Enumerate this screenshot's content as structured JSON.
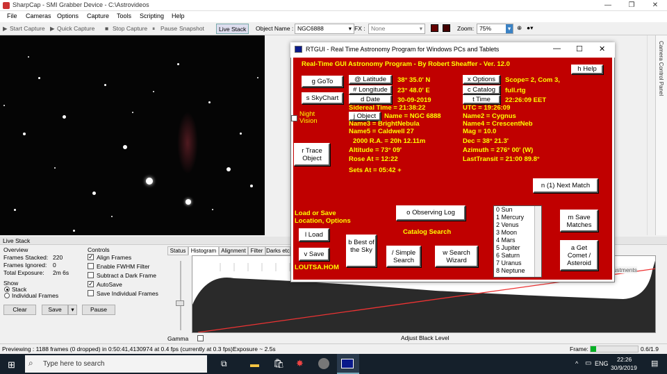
{
  "window": {
    "title": "SharpCap - SMI Grabber Device - C:\\Astrovideos"
  },
  "menu": [
    "File",
    "Cameras",
    "Options",
    "Capture",
    "Tools",
    "Scripting",
    "Help"
  ],
  "toolbar": {
    "start": "Start Capture",
    "quick": "Quick Capture",
    "stop": "Stop Capture",
    "pause": "Pause",
    "snapshot": "Snapshot",
    "livestack": "Live Stack",
    "object_label": "Object Name :",
    "object_value": "NGC6888",
    "fx_label": "FX :",
    "fx_value": "None",
    "zoom_label": "Zoom:",
    "zoom_value": "75%"
  },
  "side_panel": {
    "label": "Camera Control Panel"
  },
  "live_stack": {
    "title": "Live Stack",
    "overview_label": "Overview",
    "frames_stacked_label": "Frames Stacked:",
    "frames_stacked": "220",
    "frames_ignored_label": "Frames Ignored:",
    "frames_ignored": "0",
    "total_exposure_label": "Total Exposure:",
    "total_exposure": "2m 6s",
    "show_label": "Show",
    "show_stack": "Stack",
    "show_individual": "Individual Frames",
    "controls_label": "Controls",
    "align": "Align Frames",
    "fwhm": "Enable FWHM Filter",
    "dark": "Subtract a Dark Frame",
    "autosave": "AutoSave",
    "save_individual": "Save Individual Frames",
    "clear": "Clear",
    "save": "Save",
    "pause": "Pause",
    "tabs": [
      "Status",
      "Histogram",
      "Alignment",
      "Filter",
      "Darks etc"
    ],
    "gamma": "Gamma",
    "adjust_black": "Adjust Black Level",
    "adjustments": "t Adjustments"
  },
  "status": {
    "text": "Previewing : 1188 frames (0 dropped) in 0:50:41,4130974 at 0.4 fps  (currently at 0.3 fps)Exposure ~ 2.5s",
    "frame_label": "Frame:",
    "frame_value": "0.6/1.9"
  },
  "taskbar": {
    "search": "Type here to search",
    "lang": "ENG",
    "time": "22:26",
    "date": "30/9/2019"
  },
  "rtgui": {
    "title": "RTGUI - Real Time Astronomy Program for Windows PCs and Tablets",
    "heading": "Real-Time GUI Astronomy Program - By Robert Sheaffer - Ver. 12.0",
    "help": "h Help",
    "goto": "g GoTo",
    "skychart": "s SkyChart",
    "latitude_btn": "@ Latitude",
    "longitude_btn": "# Longitude",
    "date_btn": "d Date",
    "latitude": "38° 35.0'  N",
    "longitude": "23° 48.0'  E",
    "date": "30-09-2019",
    "options_btn": "x Options",
    "catalog_btn": "c Catalog",
    "time_btn": "t Time",
    "scope": "Scope= 2, Com 3,",
    "catalog": "full.rtg",
    "time": "22:26:09  EET",
    "sidereal": "Sidereal Time =  21:38:22",
    "utc": "UTC  =  19:26:09",
    "night_vision": "Night Vision",
    "object_btn": "j Object",
    "name": "Name = NGC 6888",
    "name2": "Name2 = Cygnus",
    "name3": "Name3 = BrightNebula",
    "name4": "Name4 = CrescentNeb",
    "name5": "Name5 = Caldwell 27",
    "mag": "Mag = 10.0",
    "ra": "2000 R.A. =  20h 12.11m",
    "dec": "Dec =  38° 21.3'",
    "trace": "r Trace Object",
    "altitude": "Altitude = 73° 09'",
    "azimuth": "Azimuth =  276° 00'  (W)",
    "rose": "Rose At = 12:22",
    "transit": "LastTransit = 21:00    89.8°",
    "sets": "Sets At = 05:42 +",
    "next_match": "n (1) Next Match",
    "load_save_label": "Load or Save Location, Options",
    "load": "l Load",
    "save": "v Save",
    "site": "LOUTSA.HOM",
    "observing_log": "o Observing Log",
    "catalog_search": "Catalog Search",
    "best": "b Best of the Sky",
    "simple": "/ Simple Search",
    "wizard": "w Search Wizard",
    "save_matches": "m Save Matches",
    "comet": "a Get Comet / Asteroid",
    "planets": [
      "0 Sun",
      "1 Mercury",
      "2 Venus",
      "3 Moon",
      "4 Mars",
      "5 Jupiter",
      "6 Saturn",
      "7 Uranus",
      "8 Neptune"
    ]
  },
  "colors": {
    "rtgui_bg": "#c00000",
    "rtgui_text": "#ffff00",
    "taskbar": "#15202b"
  }
}
